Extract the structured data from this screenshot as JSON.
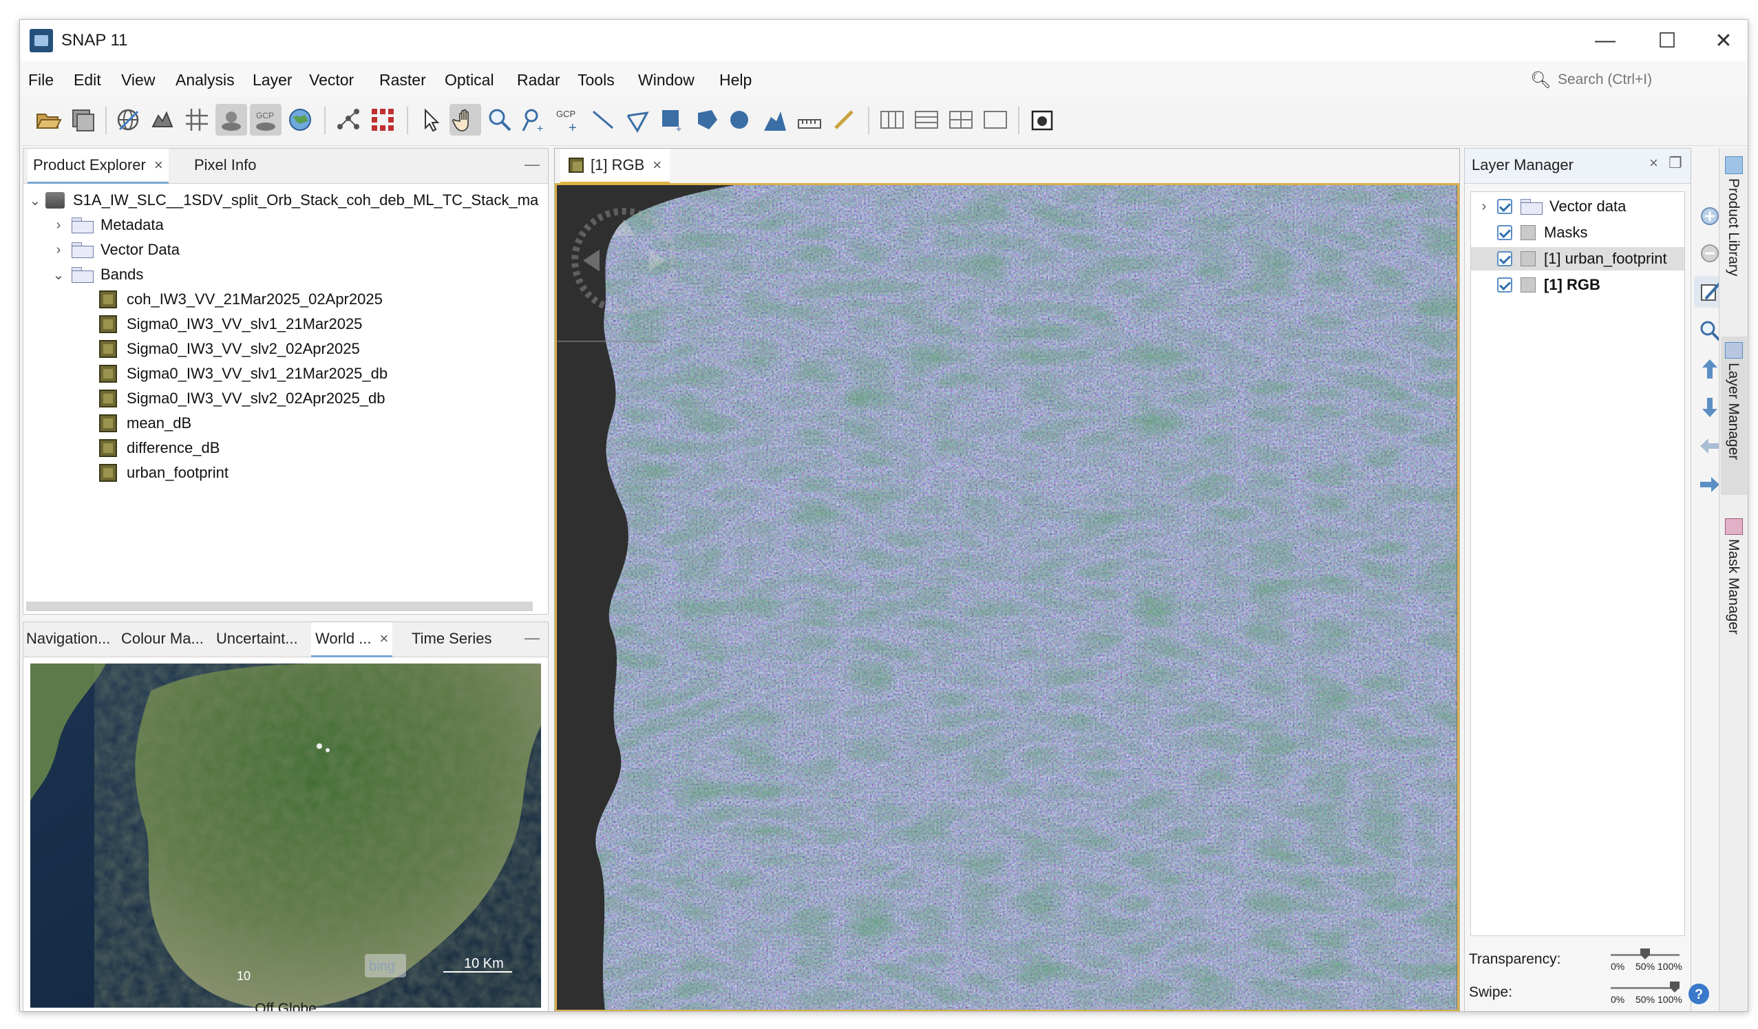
{
  "window": {
    "title": "SNAP 11"
  },
  "menu": [
    "File",
    "Edit",
    "View",
    "Analysis",
    "Layer",
    "Vector",
    "Raster",
    "Optical",
    "Radar",
    "Tools",
    "Window",
    "Help"
  ],
  "search": {
    "placeholder": "Search (Ctrl+I)"
  },
  "toolbar": {
    "gcp_label": "GCP"
  },
  "product_explorer": {
    "tabs": [
      {
        "label": "Product Explorer"
      },
      {
        "label": "Pixel Info"
      }
    ],
    "product": "S1A_IW_SLC__1SDV_split_Orb_Stack_coh_deb_ML_TC_Stack_ma",
    "folders": [
      "Metadata",
      "Vector Data",
      "Bands"
    ],
    "bands": [
      "coh_IW3_VV_21Mar2025_02Apr2025",
      "Sigma0_IW3_VV_slv1_21Mar2025",
      "Sigma0_IW3_VV_slv2_02Apr2025",
      "Sigma0_IW3_VV_slv1_21Mar2025_db",
      "Sigma0_IW3_VV_slv2_02Apr2025_db",
      "mean_dB",
      "difference_dB",
      "urban_footprint"
    ]
  },
  "bottom_panel": {
    "tabs": [
      {
        "label": "Navigation..."
      },
      {
        "label": "Colour Ma..."
      },
      {
        "label": "Uncertaint..."
      },
      {
        "label": "World ..."
      },
      {
        "label": "Time Series"
      }
    ],
    "scale_label": "10 Km",
    "scale_short": "10",
    "watermark": "bing",
    "footer": "Off Globe"
  },
  "image_view": {
    "tab_label": "[1] RGB"
  },
  "layer_manager": {
    "title": "Layer Manager",
    "layers": [
      {
        "label": "Vector data",
        "checked": true,
        "bold": false
      },
      {
        "label": "Masks",
        "checked": true,
        "bold": false
      },
      {
        "label": "[1] urban_footprint",
        "checked": true,
        "bold": false
      },
      {
        "label": "[1] RGB",
        "checked": true,
        "bold": true
      }
    ],
    "transparency_label": "Transparency:",
    "swipe_label": "Swipe:",
    "slider_ticks": [
      "0%",
      "50%",
      "100%"
    ],
    "transparency_value": 0.5,
    "swipe_value": 1.0,
    "help": "?"
  },
  "side_tabs": [
    "Product Library",
    "Layer Manager",
    "Mask Manager"
  ]
}
